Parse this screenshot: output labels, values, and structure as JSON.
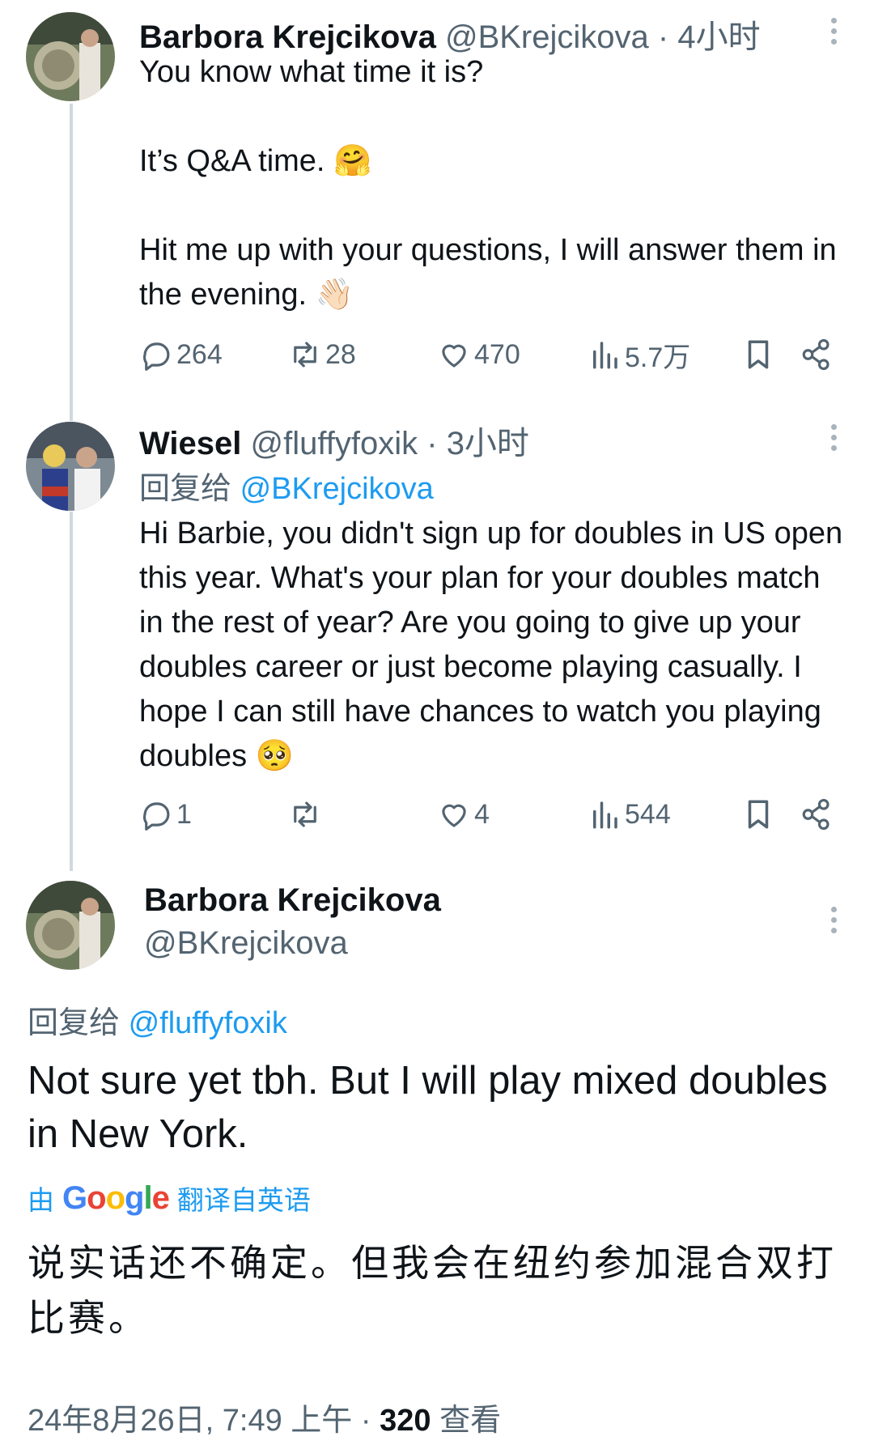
{
  "tweets": [
    {
      "author_name": "Barbora Krejcikova",
      "handle": "@BKrejcikova",
      "separator": "·",
      "time": "4小时",
      "text": "You know what time it is?\n\nIt’s Q&A time. 🤗\n\nHit me up with your questions, I will answer them in the evening. 👋🏻",
      "stats": {
        "replies": "264",
        "retweets": "28",
        "likes": "470",
        "views": "5.7万"
      }
    },
    {
      "author_name": "Wiesel",
      "handle": "@fluffyfoxik",
      "separator": "·",
      "time": "3小时",
      "reply_prefix": "回复给",
      "reply_mention": "@BKrejcikova",
      "text": "Hi Barbie, you didn't sign up for doubles in US open this year. What's your plan for your doubles match in the rest of year? Are you going to give up your doubles career or just become playing casually. I hope I can still have chances to watch you playing doubles 🥺",
      "stats": {
        "replies": "1",
        "retweets": "",
        "likes": "4",
        "views": "544"
      }
    }
  ],
  "main_tweet": {
    "author_name": "Barbora Krejcikova",
    "handle": "@BKrejcikova",
    "reply_prefix": "回复给",
    "reply_mention": "@fluffyfoxik",
    "text": "Not sure yet tbh. But I will play mixed doubles in New York.",
    "translated_by_prefix": "由",
    "translated_by_suffix": "翻译自英语",
    "google_logo_text": "Google",
    "translation": "说实话还不确定。但我会在纽约参加混合双打比赛。",
    "date": "24年8月26日, 7:49 上午",
    "separator": "·",
    "views_count": "320",
    "views_label": "查看"
  },
  "icons": {
    "reply": "reply-icon",
    "retweet": "retweet-icon",
    "like": "heart-icon",
    "views": "views-chart-icon",
    "bookmark": "bookmark-icon",
    "share": "share-icon",
    "more": "more-vertical-icon"
  },
  "colors": {
    "link": "#1d9bf0",
    "secondary_text": "#536471",
    "primary_text": "#0f1419",
    "thread_line": "#cfd9de"
  }
}
